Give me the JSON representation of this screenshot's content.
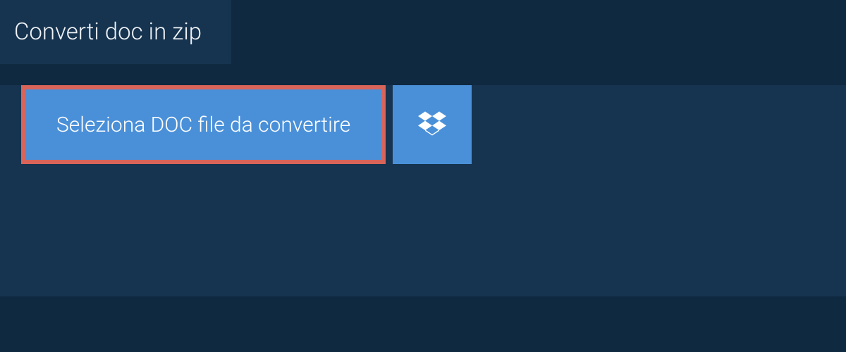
{
  "tab": {
    "title": "Converti doc in zip"
  },
  "actions": {
    "select_file_label": "Seleziona DOC file da convertire",
    "dropbox_label": "Dropbox"
  },
  "colors": {
    "background": "#0f2940",
    "panel": "#16334f",
    "button_bg": "#4a90d9",
    "highlight_border": "#d96459",
    "text": "#ffffff"
  }
}
